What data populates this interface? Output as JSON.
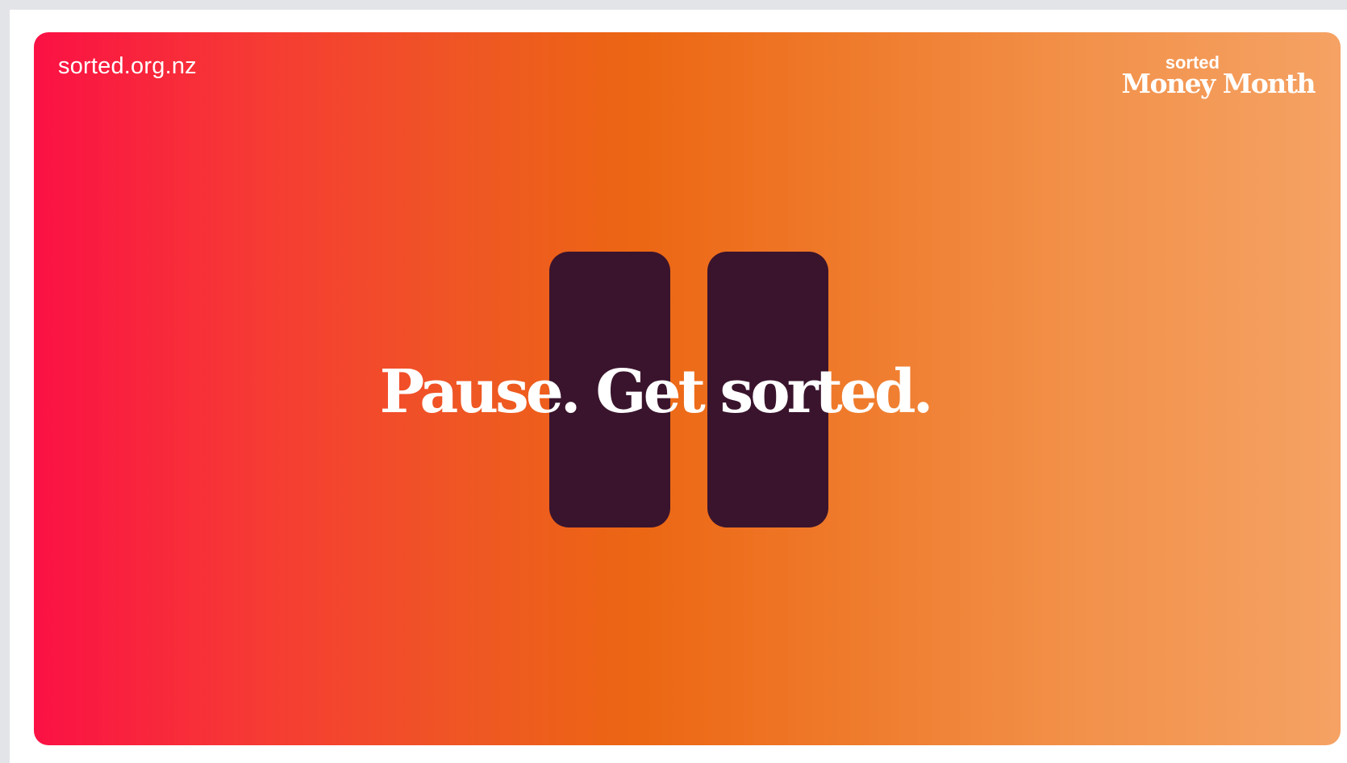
{
  "banner": {
    "site_url": "sorted.org.nz",
    "logo_small": "sorted",
    "logo_big": "Money Month",
    "headline": "Pause. Get sorted.",
    "pause_icon": "pause-icon"
  },
  "colors": {
    "gradient_start": "#fb1145",
    "gradient_mid": "#ec6613",
    "gradient_end": "#f5a264",
    "pause_bars": "#3a142d",
    "text": "#ffffff"
  }
}
